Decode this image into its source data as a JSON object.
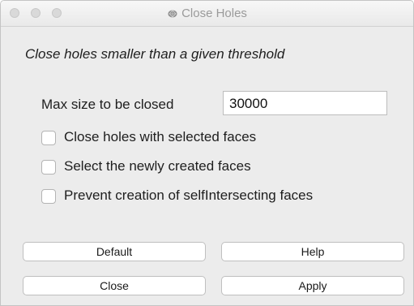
{
  "window": {
    "title": "Close Holes",
    "title_icon": "mesh-icon"
  },
  "dialog": {
    "description": "Close holes smaller than a given threshold",
    "max_size_label": "Max size to be closed",
    "max_size_value": "30000"
  },
  "options": [
    {
      "label": "Close holes with selected faces",
      "checked": false
    },
    {
      "label": "Select the newly created faces",
      "checked": false
    },
    {
      "label": "Prevent creation of selfIntersecting faces",
      "checked": false
    }
  ],
  "buttons": {
    "default": "Default",
    "help": "Help",
    "close": "Close",
    "apply": "Apply"
  }
}
